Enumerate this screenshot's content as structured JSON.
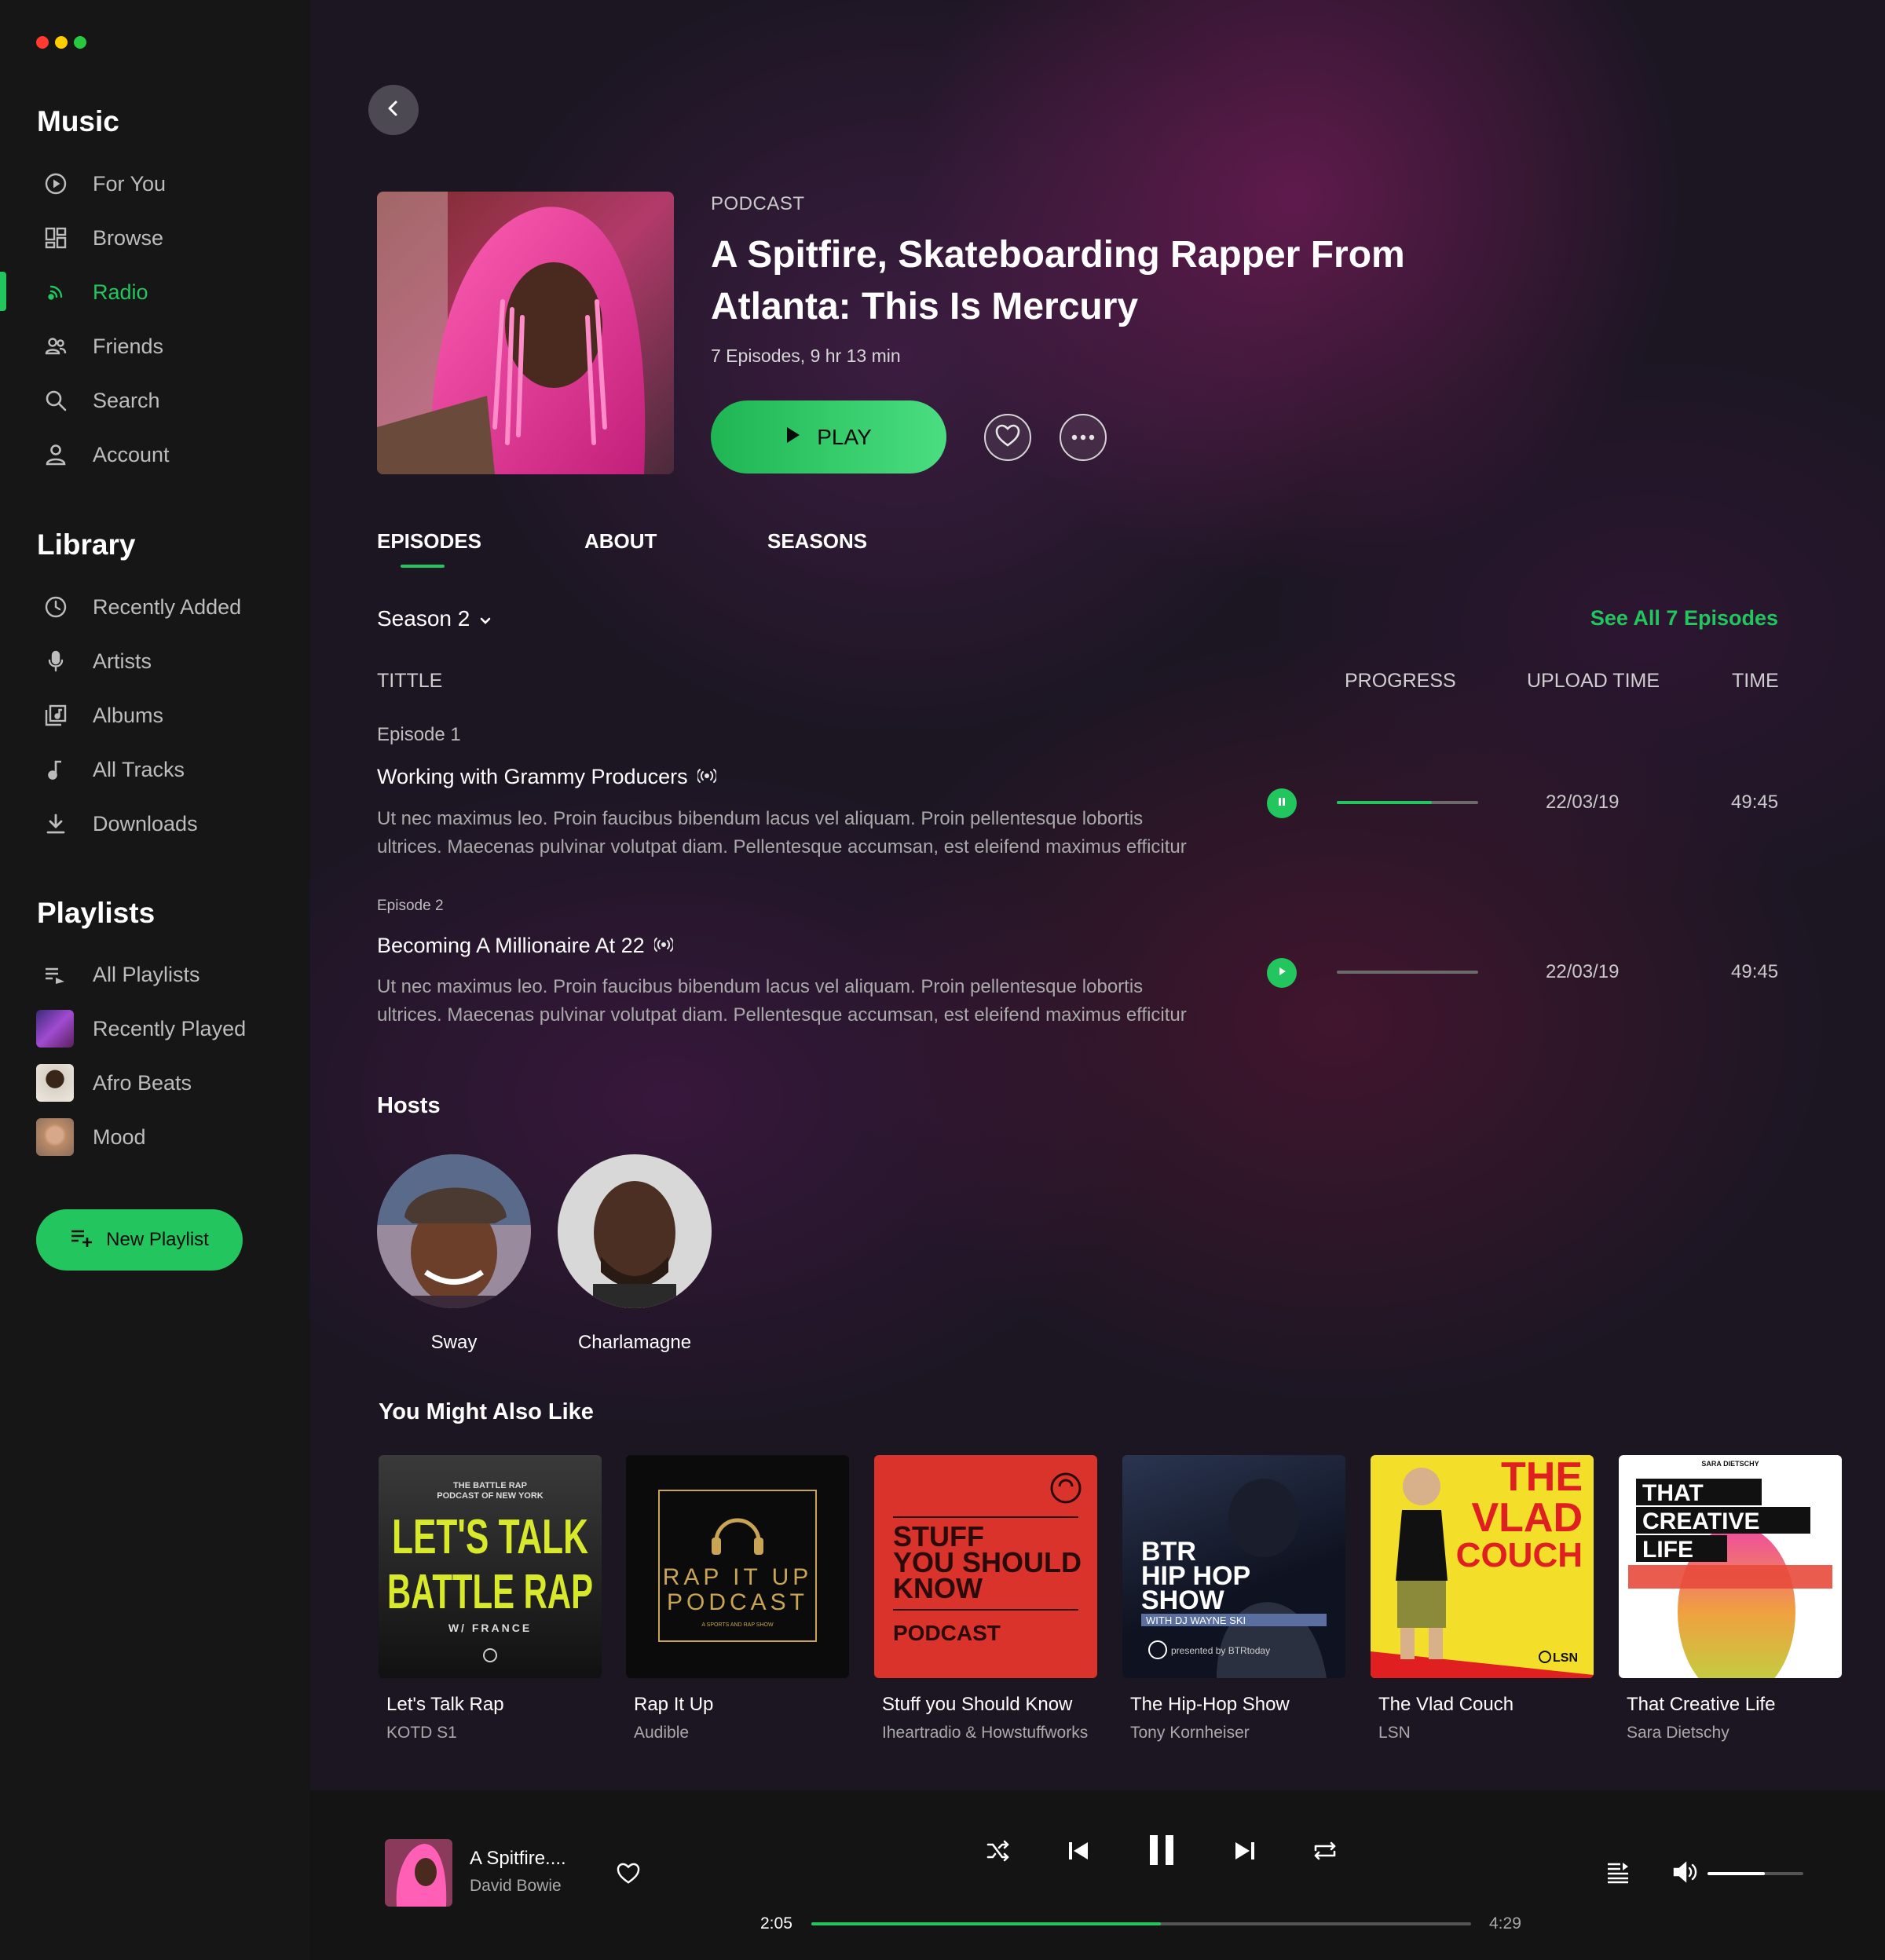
{
  "sidebar": {
    "music_title": "Music",
    "music_items": [
      {
        "label": "For You",
        "icon": "play-circle-icon"
      },
      {
        "label": "Browse",
        "icon": "grid-icon"
      },
      {
        "label": "Radio",
        "icon": "radio-icon",
        "active": true
      },
      {
        "label": "Friends",
        "icon": "friends-icon"
      },
      {
        "label": "Search",
        "icon": "search-icon"
      },
      {
        "label": "Account",
        "icon": "account-icon"
      }
    ],
    "library_title": "Library",
    "library_items": [
      {
        "label": "Recently Added",
        "icon": "clock-icon"
      },
      {
        "label": "Artists",
        "icon": "mic-icon"
      },
      {
        "label": "Albums",
        "icon": "album-icon"
      },
      {
        "label": "All Tracks",
        "icon": "note-icon"
      },
      {
        "label": "Downloads",
        "icon": "download-icon"
      }
    ],
    "playlists_title": "Playlists",
    "playlist_items": [
      {
        "label": "All Playlists",
        "icon": "playlist-icon"
      },
      {
        "label": "Recently Played"
      },
      {
        "label": "Afro Beats"
      },
      {
        "label": "Mood"
      }
    ],
    "new_playlist_label": "New Playlist"
  },
  "podcast": {
    "eyebrow": "PODCAST",
    "title_line1": "A Spitfire, Skateboarding Rapper From",
    "title_line2": "Atlanta: This Is Mercury",
    "meta": "7 Episodes, 9 hr 13 min",
    "play_label": "PLAY"
  },
  "tabs": [
    "EPISODES",
    "ABOUT",
    "SEASONS"
  ],
  "season_selector": "Season 2",
  "see_all_label": "See All 7 Episodes",
  "columns": {
    "title": "TITTLE",
    "progress": "PROGRESS",
    "upload": "UPLOAD TIME",
    "time": "TIME"
  },
  "episodes": [
    {
      "label": "Episode 1",
      "title": "Working with Grammy Producers",
      "desc_line1": "Ut nec maximus leo. Proin faucibus bibendum lacus vel aliquam. Proin pellentesque lobortis",
      "desc_line2": "ultrices. Maecenas pulvinar volutpat diam. Pellentesque accumsan, est eleifend maximus efficitur",
      "state": "playing",
      "progress": 0.67,
      "upload": "22/03/19",
      "time": "49:45"
    },
    {
      "label": "Episode 2",
      "title": "Becoming A Millionaire At 22",
      "desc_line1": "Ut nec maximus leo. Proin faucibus bibendum lacus vel aliquam. Proin pellentesque lobortis",
      "desc_line2": "ultrices. Maecenas pulvinar volutpat diam. Pellentesque accumsan, est eleifend maximus efficitur",
      "state": "paused",
      "progress": 0,
      "upload": "22/03/19",
      "time": "49:45"
    }
  ],
  "hosts_title": "Hosts",
  "hosts": [
    {
      "name": "Sway"
    },
    {
      "name": "Charlamagne"
    }
  ],
  "recs_title": "You Might Also Like",
  "recommendations": [
    {
      "title": "Let's Talk Rap",
      "subtitle": "KOTD S1",
      "art_top": "THE BATTLE RAP",
      "art_top2": "PODCAST OF NEW YORK",
      "art_line1": "LET'S TALK",
      "art_line2": "BATTLE RAP",
      "art_bottom": "W/ FRANCE"
    },
    {
      "title": "Rap It Up",
      "subtitle": "Audible",
      "art_line1": "RAP IT UP",
      "art_line2": "PODCAST",
      "art_small": "A SPORTS AND RAP SHOW"
    },
    {
      "title": "Stuff you Should Know",
      "subtitle": "Iheartradio & Howstuffworks",
      "art_line1": "STUFF",
      "art_line2": "YOU SHOULD",
      "art_line3": "KNOW",
      "art_line4": "PODCAST"
    },
    {
      "title": "The Hip-Hop Show",
      "subtitle": "Tony Kornheiser",
      "art_line1": "BTR",
      "art_line2": "HIP HOP",
      "art_line3": "SHOW",
      "art_line4": "WITH DJ WAYNE SKI",
      "art_small": "presented by BTRtoday"
    },
    {
      "title": "The Vlad Couch",
      "subtitle": "LSN",
      "art_line1": "THE",
      "art_line2": "VLAD",
      "art_line3": "COUCH",
      "art_small": "LSN"
    },
    {
      "title": "That Creative Life",
      "subtitle": "Sara Dietschy",
      "art_top": "SARA DIETSCHY",
      "art_line1": "THAT",
      "art_line2": "CREATIVE",
      "art_line3": "LIFE"
    }
  ],
  "player": {
    "title": "A Spitfire....",
    "artist": "David Bowie",
    "elapsed": "2:05",
    "duration": "4:29",
    "progress": 0.53,
    "volume": 0.6
  },
  "colors": {
    "accent": "#22c55e",
    "sidebar_bg": "#161616",
    "player_bg": "#141414",
    "traffic": [
      "#ff3b30",
      "#ffcc00",
      "#28c840"
    ]
  }
}
